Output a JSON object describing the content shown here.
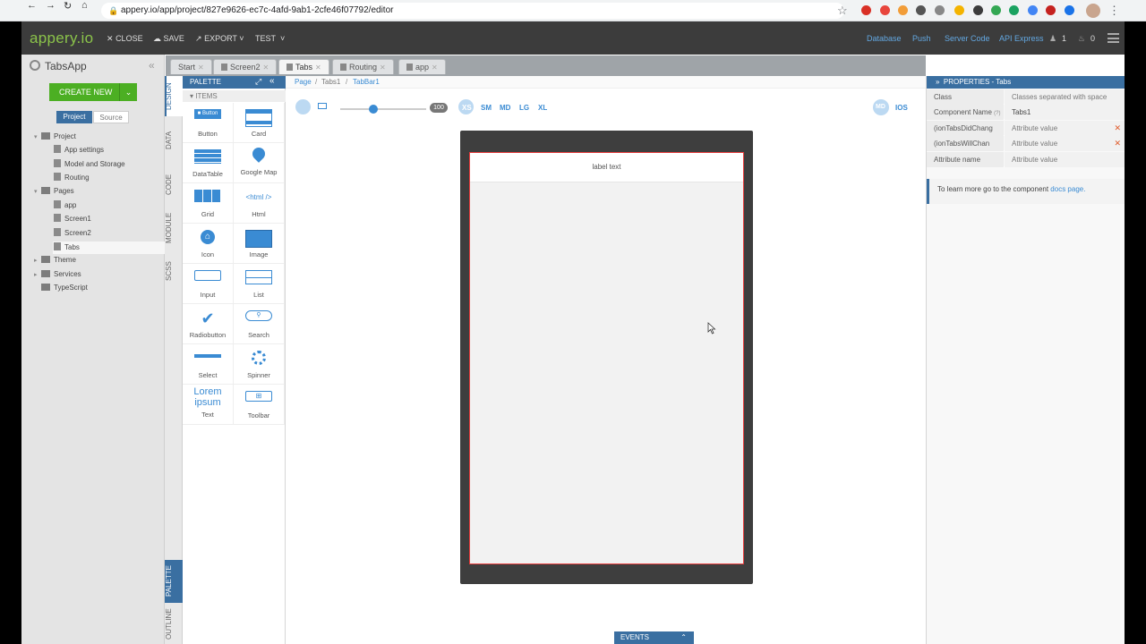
{
  "browser": {
    "url": "appery.io/app/project/827e9626-ec7c-4afd-9ab1-2cfe46f07792/editor"
  },
  "topbar": {
    "logo": "appery.io",
    "close": "CLOSE",
    "save": "SAVE",
    "export": "EXPORT",
    "test": "TEST",
    "links": [
      "Database",
      "Push",
      "Server Code",
      "API Express"
    ],
    "user_count": "1",
    "notif_count": "0"
  },
  "project": {
    "name": "TabsApp",
    "create_new": "CREATE NEW",
    "seg_project": "Project",
    "seg_source": "Source",
    "tree": {
      "project": "Project",
      "app_settings": "App settings",
      "model_storage": "Model and Storage",
      "routing": "Routing",
      "pages": "Pages",
      "app": "app",
      "screen1": "Screen1",
      "screen2": "Screen2",
      "tabs": "Tabs",
      "theme": "Theme",
      "services": "Services",
      "typescript": "TypeScript"
    }
  },
  "vtabs": {
    "design": "DESIGN",
    "data": "DATA",
    "code": "CODE",
    "module": "MODULE",
    "scss": "SCSS",
    "palette": "PALETTE",
    "outline": "OUTLINE"
  },
  "palette": {
    "title": "PALETTE",
    "items_title": "ITEMS",
    "items": [
      {
        "label": "Button",
        "icon": "button-icon"
      },
      {
        "label": "Card",
        "icon": "card-icon"
      },
      {
        "label": "DataTable",
        "icon": "datatable-icon"
      },
      {
        "label": "Google Map",
        "icon": "map-pin-icon"
      },
      {
        "label": "Grid",
        "icon": "grid-icon"
      },
      {
        "label": "Html",
        "icon": "html-icon",
        "glyph": "<html />"
      },
      {
        "label": "Icon",
        "icon": "home-icon"
      },
      {
        "label": "Image",
        "icon": "image-icon"
      },
      {
        "label": "Input",
        "icon": "input-icon"
      },
      {
        "label": "List",
        "icon": "list-icon"
      },
      {
        "label": "Radiobutton",
        "icon": "check-icon"
      },
      {
        "label": "Search",
        "icon": "search-icon"
      },
      {
        "label": "Select",
        "icon": "select-icon"
      },
      {
        "label": "Spinner",
        "icon": "spinner-icon"
      },
      {
        "label": "Text",
        "icon": "text-icon",
        "glyph": "Lorem ipsum"
      },
      {
        "label": "Toolbar",
        "icon": "toolbar-icon"
      }
    ]
  },
  "filetabs": [
    "Start",
    "Screen2",
    "Tabs",
    "Routing",
    "app"
  ],
  "breadcrumb": {
    "page": "Page",
    "tabs1": "Tabs1",
    "tabbar1": "TabBar1"
  },
  "toolbar": {
    "zoom": "100",
    "breakpoints": [
      "XS",
      "SM",
      "MD",
      "LG",
      "XL"
    ],
    "mode_md": "MD",
    "mode_ios": "IOS"
  },
  "canvas": {
    "label_text": "label text"
  },
  "events_label": "EVENTS",
  "properties": {
    "title": "PROPERTIES - Tabs",
    "rows": [
      {
        "key": "Class",
        "value": "Classes separated with space",
        "removable": false
      },
      {
        "key": "Component Name",
        "value": "Tabs1",
        "removable": false
      },
      {
        "key": "(ionTabsDidChang",
        "value": "Attribute value",
        "removable": true
      },
      {
        "key": "(ionTabsWillChan",
        "value": "Attribute value",
        "removable": true
      },
      {
        "key": "Attribute name",
        "value": "Attribute value",
        "removable": false
      }
    ],
    "docs_prefix": "To learn more go to the component ",
    "docs_link": "docs page."
  },
  "colors": {
    "accent": "#3a6fa1",
    "brand_green": "#4caf23",
    "selection_red": "#e63c3c"
  }
}
